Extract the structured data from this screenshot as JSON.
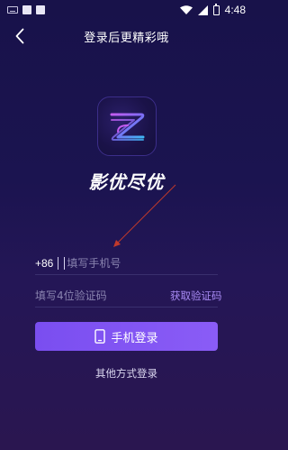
{
  "status_bar": {
    "time": "4:48",
    "icons": [
      "keyboard-icon",
      "notification-icon",
      "notification-icon",
      "wifi-icon",
      "signal-icon",
      "battery-icon"
    ]
  },
  "nav": {
    "back_icon": "chevron-left-icon",
    "title": "登录后更精彩哦"
  },
  "brand": {
    "logo_icon": "z-logo-icon",
    "name": "影优尽优"
  },
  "form": {
    "country_code": "+86",
    "phone_placeholder": "填写手机号",
    "code_placeholder": "填写4位验证码",
    "get_code_label": "获取验证码"
  },
  "login_button": {
    "icon": "smartphone-icon",
    "label": "手机登录"
  },
  "other_login_label": "其他方式登录",
  "colors": {
    "background": "#1b1450",
    "accent": "#8a5cf6",
    "link": "#a98bf5",
    "annotation_arrow": "#c0392b"
  }
}
